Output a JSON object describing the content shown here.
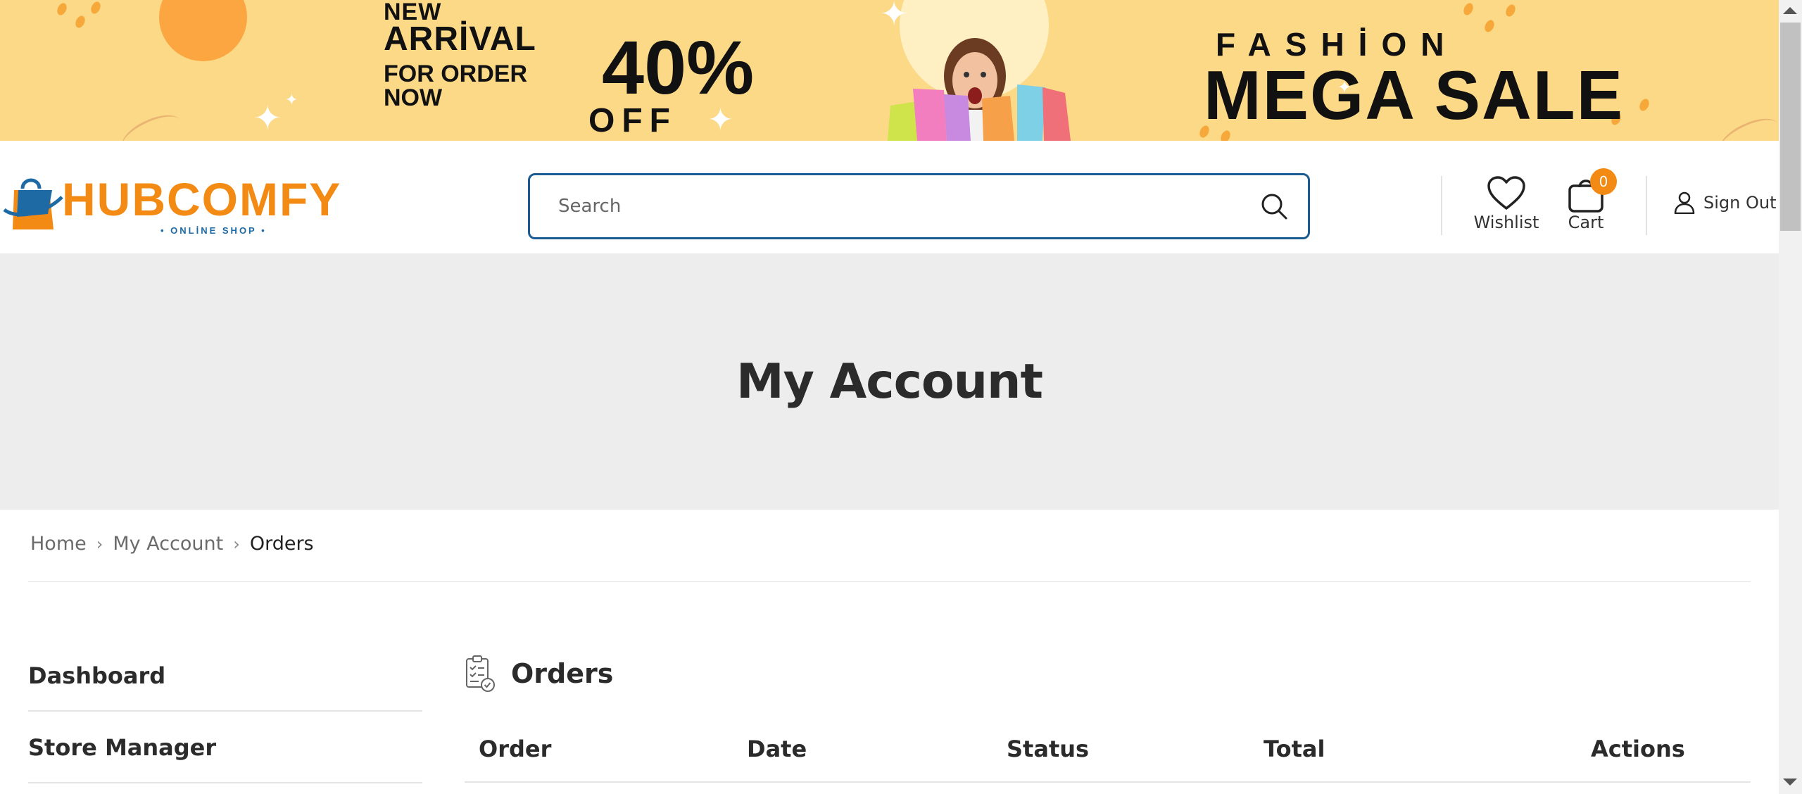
{
  "banner": {
    "new": "NEW",
    "arrival": "ARRİVAL",
    "for_order": "FOR ORDER",
    "now": "NOW",
    "percent": "40%",
    "off": "OFF",
    "fashion": "FASHİON",
    "mega_sale": "MEGA SALE"
  },
  "header": {
    "logo_text": "HUBCOMFY",
    "logo_sub": "• ONLİNE SHOP •",
    "search_placeholder": "Search",
    "wishlist_label": "Wishlist",
    "cart_label": "Cart",
    "cart_count": "0",
    "signout_label": "Sign Out"
  },
  "hero": {
    "title": "My Account"
  },
  "breadcrumb": {
    "home": "Home",
    "account": "My Account",
    "current": "Orders"
  },
  "sidebar": {
    "items": [
      {
        "label": "Dashboard"
      },
      {
        "label": "Store Manager"
      }
    ]
  },
  "orders": {
    "title": "Orders",
    "columns": [
      "Order",
      "Date",
      "Status",
      "Total",
      "Actions"
    ]
  },
  "colors": {
    "accent": "#f38a13",
    "brand_blue": "#1a5c92",
    "banner_bg": "#fcd987",
    "hero_bg": "#ededed"
  },
  "icons": [
    "search-icon",
    "heart-icon",
    "cart-icon",
    "user-icon",
    "clipboard-check-icon",
    "chevron-right-icon",
    "shopping-bag-logo-icon"
  ]
}
